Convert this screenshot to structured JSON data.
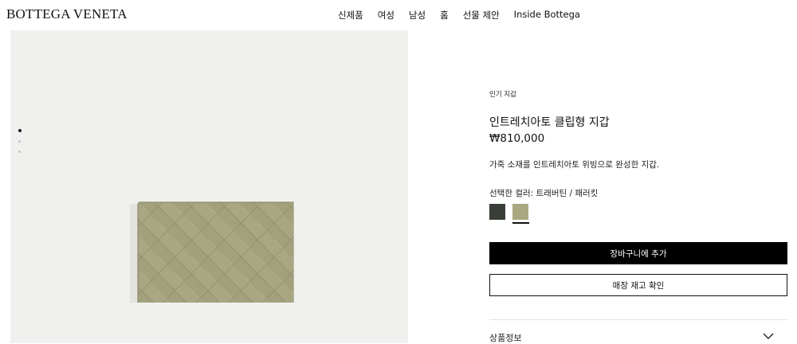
{
  "header": {
    "logo": "BOTTEGA VENETA",
    "nav": [
      "신제품",
      "여성",
      "남성",
      "홈",
      "선물 제안",
      "Inside Bottega"
    ]
  },
  "gallery": {
    "image_count": 3,
    "active_index": 0
  },
  "product": {
    "eyebrow": "인기 지갑",
    "title": "인트레치아토 클립형 지갑",
    "price": "₩810,000",
    "description": "가죽 소재를 인트레치아토 위빙으로 완성한 지갑.",
    "color_label": "선택한 컬러: 트래버틴 / 패러킷",
    "swatches": [
      {
        "color": "#3a3e38",
        "selected": false
      },
      {
        "color": "#a9a782",
        "selected": true
      }
    ],
    "add_to_cart": "장바구니에 추가",
    "check_stock": "매장 재고 확인",
    "accordion_label": "상품정보"
  },
  "colors": {
    "gallery_bg": "#f0f1ef",
    "wallet": "#a9a782",
    "button_primary": "#000000"
  }
}
